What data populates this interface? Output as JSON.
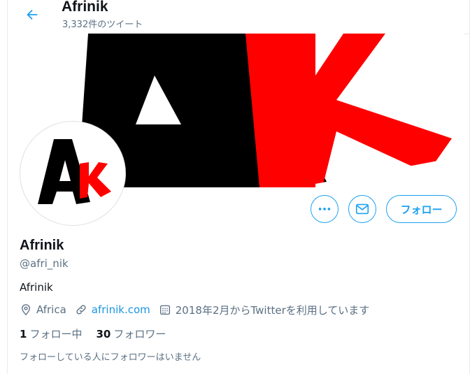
{
  "header": {
    "name": "Afrinik",
    "tweet_count": "3,332件のツイート"
  },
  "profile": {
    "name": "Afrinik",
    "handle": "@afri_nik",
    "bio": "Afrinik",
    "location": "Africa",
    "website": "afrinik.com",
    "joined": "2018年2月からTwitterを利用しています",
    "following_count": "1",
    "following_label": "フォロー中",
    "followers_count": "30",
    "followers_label": "フォロワー",
    "known_followers": "フォローしている人にフォロワーはいません"
  },
  "buttons": {
    "follow": "フォロー"
  },
  "logo_text": "AK",
  "icons": [
    "back-arrow-icon",
    "more-icon",
    "mail-icon",
    "location-icon",
    "link-icon",
    "calendar-icon"
  ],
  "colors": {
    "accent": "#1da1f2",
    "link": "#1b95e0",
    "muted": "#5b7083",
    "logo_red": "#ff0000",
    "logo_black": "#000000"
  }
}
